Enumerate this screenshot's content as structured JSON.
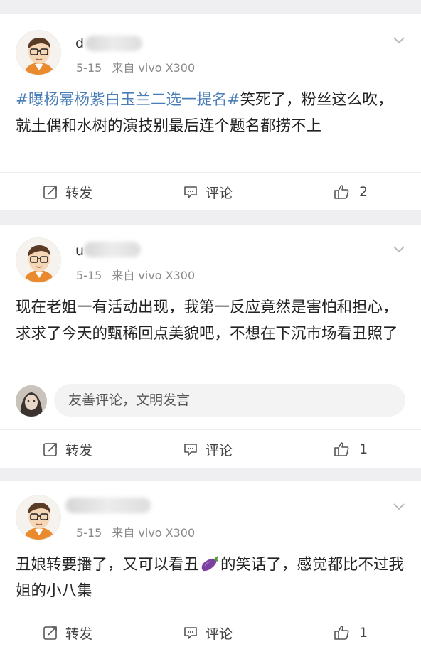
{
  "posts": [
    {
      "username": "d",
      "date": "5-15",
      "source": "来自 vivo X300",
      "topic": "#曝杨幂杨紫白玉兰二选一提名#",
      "content": "笑死了，粉丝这么吹，就土偶和水树的演技别最后连个题名都捞不上",
      "actions": {
        "repost": "转发",
        "comment": "评论",
        "like_count": "2"
      }
    },
    {
      "username": "u",
      "date": "5-15",
      "source": "来自 vivo X300",
      "content": "现在老姐一有活动出现，我第一反应竟然是害怕和担心，求求了今天的甄稀回点美貌吧，不想在下沉市场看丑照了",
      "comment_placeholder": "友善评论，文明发言",
      "actions": {
        "repost": "转发",
        "comment": "评论",
        "like_count": "1"
      }
    },
    {
      "username": "",
      "date": "5-15",
      "source": "来自 vivo X300",
      "content_before_emoji": "丑娘转要播了，又可以看丑",
      "emoji": "eggplant-emoji",
      "content_after_emoji": "的笑话了，感觉都比不过我姐的小八集",
      "actions": {
        "repost": "转发",
        "comment": "评论",
        "like_count": "1"
      }
    }
  ],
  "colors": {
    "topic": "#4a7eb8",
    "background": "#efeff2",
    "meta": "#8a8a8a"
  }
}
